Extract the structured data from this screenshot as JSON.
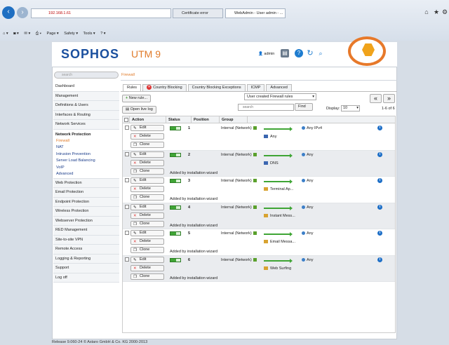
{
  "browser": {
    "address": "192.168.1.61",
    "tabs": [
      "Certificate error",
      "WebAdmin - User admin - ..."
    ],
    "toolbar": [
      "Page ▾",
      "Safety ▾",
      "Tools ▾"
    ]
  },
  "header": {
    "logo": "SOPHOS",
    "product": "UTM 9",
    "user": "admin"
  },
  "search_placeholder": "search",
  "breadcrumb": "Firewall",
  "sidebar": {
    "items_top": [
      "Dashboard",
      "Management",
      "Definitions & Users",
      "Interfaces & Routing",
      "Network Services"
    ],
    "section": "Network Protection",
    "sub_items": [
      "Firewall",
      "NAT",
      "Intrusion Prevention",
      "Server Load Balancing",
      "VoIP",
      "Advanced"
    ],
    "items_bottom": [
      "Web Protection",
      "Email Protection",
      "Endpoint Protection",
      "Wireless Protection",
      "Webserver Protection",
      "RED Management",
      "Site-to-site VPN",
      "Remote Access",
      "Logging & Reporting",
      "Support",
      "Log off"
    ]
  },
  "tabs": [
    "Rules",
    "Country Blocking",
    "Country Blocking Exceptions",
    "ICMP",
    "Advanced"
  ],
  "controls": {
    "new_rule": "New rule...",
    "live_log": "Open live log",
    "filter_select": "User created Firewall rules",
    "search_placeholder": "search",
    "find": "Find",
    "display_label": "Display:",
    "display_value": "10",
    "count": "1-6 of 6",
    "prev": "«",
    "next": "»"
  },
  "table": {
    "headers": [
      "Action",
      "Status",
      "Position",
      "Group"
    ],
    "buttons": {
      "edit": "Edit",
      "delete": "Delete",
      "clone": "Clone"
    },
    "rows": [
      {
        "position": "1",
        "source": "Internal (Network)",
        "service": "Any",
        "dest": "Any IPv4",
        "comment": "",
        "svc_icon": "net"
      },
      {
        "position": "2",
        "source": "Internal (Network)",
        "service": "DNS",
        "dest": "Any",
        "comment": "Added by installation wizard",
        "svc_icon": "net"
      },
      {
        "position": "3",
        "source": "Internal (Network)",
        "service": "Terminal Ap...",
        "dest": "Any",
        "comment": "Added by installation wizard",
        "svc_icon": "grp"
      },
      {
        "position": "4",
        "source": "Internal (Network)",
        "service": "Instant Mess...",
        "dest": "Any",
        "comment": "Added by installation wizard",
        "svc_icon": "grp"
      },
      {
        "position": "5",
        "source": "Internal (Network)",
        "service": "Email Messa...",
        "dest": "Any",
        "comment": "Added by installation wizard",
        "svc_icon": "grp"
      },
      {
        "position": "6",
        "source": "Internal (Network)",
        "service": "Web Surfing",
        "dest": "Any",
        "comment": "Added by installation wizard",
        "svc_icon": "grp"
      }
    ]
  },
  "footer": "Release 9.060-24  © Astaro GmbH & Co. KG 2000-2013"
}
